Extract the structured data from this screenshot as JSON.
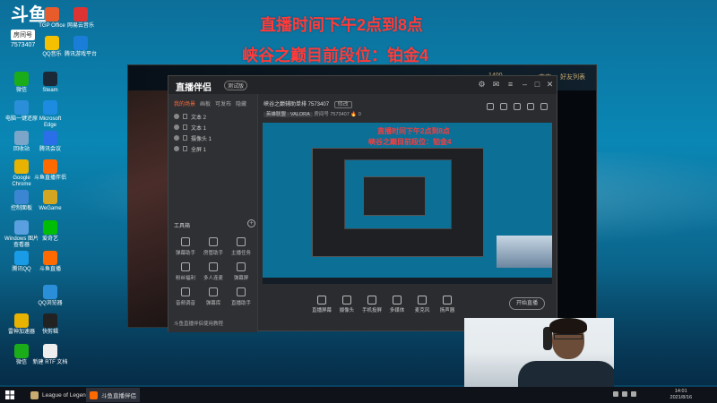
{
  "overlay": {
    "caption_line1": "直播时间下午2点到8点",
    "caption_line2": "峡谷之巅目前段位：铂金4",
    "caption_color": "#ff3b3b"
  },
  "douyu": {
    "logo_text": "斗鱼",
    "room_label": "房间号",
    "room_number": "7573407"
  },
  "desktop_icons": [
    {
      "label": "TGP\nOffice",
      "color": "#e85c2c"
    },
    {
      "label": "网易云音乐",
      "color": "#d33"
    },
    {
      "label": "QQ音乐",
      "color": "#f5c000"
    },
    {
      "label": "腾讯游戏平台",
      "color": "#1a7ed8"
    },
    {
      "label": "魔兽争霸官方对战平台",
      "color": "#444"
    },
    {
      "label": "微信",
      "color": "#1aad19"
    },
    {
      "label": "Steam",
      "color": "#1b2838"
    },
    {
      "label": "电脑一键还原",
      "color": "#2a8fd8"
    },
    {
      "label": "Microsoft Edge",
      "color": "#1d8be0"
    },
    {
      "label": "回收站",
      "color": "#7ba6c9"
    },
    {
      "label": "腾讯会议",
      "color": "#2a6ee8"
    },
    {
      "label": "Google Chrome",
      "color": "#e8b200"
    },
    {
      "label": "斗鱼直播伴侣",
      "color": "#ff6a00"
    },
    {
      "label": "控制面板",
      "color": "#3b86d3"
    },
    {
      "label": "WeGame",
      "color": "#d4a520"
    },
    {
      "label": "Windows 图片查看器",
      "color": "#5aa0e0"
    },
    {
      "label": "爱奇艺",
      "color": "#00be06"
    },
    {
      "label": "腾讯QQ",
      "color": "#1a9be6"
    },
    {
      "label": "斗鱼直播",
      "color": "#ff6a00"
    },
    {
      "label": "英雄联盟",
      "color": "#c9aa71"
    },
    {
      "label": "QQ浏览器",
      "color": "#2a8fd8"
    },
    {
      "label": "雷神加速器",
      "color": "#e8b200"
    },
    {
      "label": "快剪辑",
      "color": "#222"
    },
    {
      "label": "微信",
      "color": "#1aad19"
    },
    {
      "label": "新建 RTF 文档",
      "color": "#eee"
    }
  ],
  "game_client": {
    "stat_1": "1400",
    "stat_2": "商店",
    "stat_3": "好友列表"
  },
  "obs": {
    "brand": "直播伴侣",
    "brand_tag": "测试版",
    "side_tabs": [
      "我的场景",
      "画板",
      "可发布",
      "隐藏"
    ],
    "scenes": [
      "文本 2",
      "文本 1",
      "摄像头 1",
      "全屏 1"
    ],
    "tools_header": "工具箱",
    "tools": [
      "弹幕助手",
      "房管助手",
      "主播任务",
      "粉丝福利",
      "多人连麦",
      "弹幕屏",
      "音频调音",
      "弹幕库",
      "直播助手",
      "礼物录音",
      "语音",
      "直播间"
    ],
    "footer": "斗鱼直播伴侣使用教程",
    "room_title": "峡谷之巅辅助单排 7573407",
    "room_badge": "修改",
    "sub_category": "英雄联盟 · VALORA",
    "sub_id": "房间号 7573407",
    "sub_hot": "0",
    "preview_caption1": "直播时间下午2点到8点",
    "preview_caption2": "峡谷之巅目前段位：铂金4",
    "bottom_buttons": [
      "直播屏幕",
      "摄像头",
      "手机投屏",
      "多媒体",
      "麦克风",
      "扬声器"
    ],
    "start_live": "开始直播"
  },
  "taskbar": {
    "apps": [
      "League of Legends",
      "斗鱼直播伴侣"
    ],
    "time": "14:01",
    "date": "2021/8/16"
  }
}
